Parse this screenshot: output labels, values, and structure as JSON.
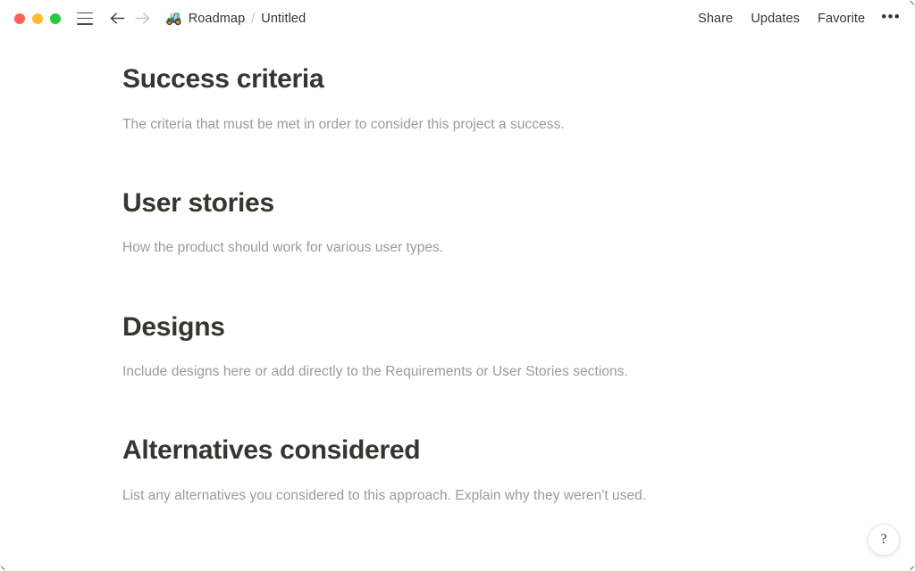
{
  "window": {
    "traffic_lights": [
      {
        "name": "close",
        "color": "#FF5F57"
      },
      {
        "name": "minimize",
        "color": "#FEBC2E"
      },
      {
        "name": "maximize",
        "color": "#28C840"
      }
    ]
  },
  "titlebar": {
    "menu_icon": "hamburger-icon",
    "back_icon": "arrow-left-icon",
    "forward_icon": "arrow-right-icon",
    "breadcrumb": {
      "emoji": "🚜",
      "parent": "Roadmap",
      "separator": "/",
      "current": "Untitled"
    },
    "actions": [
      {
        "label": "Share"
      },
      {
        "label": "Updates"
      },
      {
        "label": "Favorite"
      }
    ],
    "more_label": "•••"
  },
  "document": {
    "sections": [
      {
        "heading": "Success criteria",
        "description": "The criteria that must be met in order to consider this project a success."
      },
      {
        "heading": "User stories",
        "description": "How the product should work for various user types."
      },
      {
        "heading": "Designs",
        "description": "Include designs here or add directly to the Requirements or User Stories sections."
      },
      {
        "heading": "Alternatives considered",
        "description": "List any alternatives you considered to this approach. Explain why they weren't used."
      }
    ]
  },
  "help": {
    "label": "?"
  },
  "colors": {
    "heading_text": "#37352F",
    "description_text": "#9B9A97",
    "background": "#FFFFFF",
    "separator": "#C0BFBB"
  }
}
